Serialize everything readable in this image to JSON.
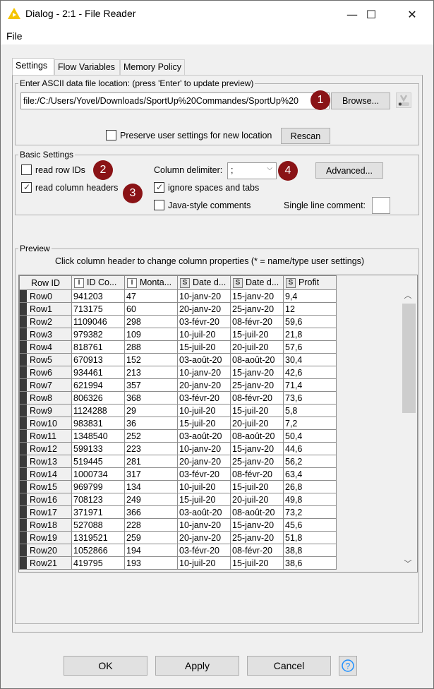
{
  "window": {
    "title": "Dialog - 2:1 - File Reader",
    "controls": {
      "minimize": "—",
      "maximize": "☐",
      "close": "✕"
    }
  },
  "menu": {
    "items": [
      "File"
    ]
  },
  "tabs": [
    {
      "label": "Settings",
      "active": true
    },
    {
      "label": "Flow Variables",
      "active": false
    },
    {
      "label": "Memory Policy",
      "active": false
    }
  ],
  "file_location": {
    "legend": "Enter ASCII data file location: (press 'Enter' to update preview)",
    "path": "file:/C:/Users/Yovel/Downloads/SportUp%20Commandes/SportUp%20",
    "browse_label": "Browse...",
    "preserve_label": "Preserve user settings for new location",
    "preserve_checked": false,
    "rescan_label": "Rescan"
  },
  "basic_settings": {
    "legend": "Basic Settings",
    "read_row_ids_label": "read row IDs",
    "read_row_ids_checked": false,
    "read_column_headers_label": "read column headers",
    "read_column_headers_checked": true,
    "column_delimiter_label": "Column delimiter:",
    "column_delimiter_value": ";",
    "advanced_label": "Advanced...",
    "ignore_spaces_label": "ignore spaces and tabs",
    "ignore_spaces_checked": true,
    "java_comments_label": "Java-style comments",
    "java_comments_checked": false,
    "single_line_comment_label": "Single line comment:",
    "single_line_comment_value": ""
  },
  "badges": [
    "1",
    "2",
    "3",
    "4"
  ],
  "preview": {
    "legend": "Preview",
    "hint": "Click column header to change column properties (* = name/type user settings)",
    "columns": [
      {
        "label": "Row ID",
        "type": ""
      },
      {
        "label": "ID Co...",
        "type": "I"
      },
      {
        "label": "Monta...",
        "type": "I"
      },
      {
        "label": "Date d...",
        "type": "S"
      },
      {
        "label": "Date d...",
        "type": "S"
      },
      {
        "label": "Profit",
        "type": "S"
      }
    ],
    "rows": [
      [
        "Row0",
        "941203",
        "47",
        "10-janv-20",
        "15-janv-20",
        "9,4"
      ],
      [
        "Row1",
        "713175",
        "60",
        "20-janv-20",
        "25-janv-20",
        "12"
      ],
      [
        "Row2",
        "1109046",
        "298",
        "03-févr-20",
        "08-févr-20",
        "59,6"
      ],
      [
        "Row3",
        "979382",
        "109",
        "10-juil-20",
        "15-juil-20",
        "21,8"
      ],
      [
        "Row4",
        "818761",
        "288",
        "15-juil-20",
        "20-juil-20",
        "57,6"
      ],
      [
        "Row5",
        "670913",
        "152",
        "03-août-20",
        "08-août-20",
        "30,4"
      ],
      [
        "Row6",
        "934461",
        "213",
        "10-janv-20",
        "15-janv-20",
        "42,6"
      ],
      [
        "Row7",
        "621994",
        "357",
        "20-janv-20",
        "25-janv-20",
        "71,4"
      ],
      [
        "Row8",
        "806326",
        "368",
        "03-févr-20",
        "08-févr-20",
        "73,6"
      ],
      [
        "Row9",
        "1124288",
        "29",
        "10-juil-20",
        "15-juil-20",
        "5,8"
      ],
      [
        "Row10",
        "983831",
        "36",
        "15-juil-20",
        "20-juil-20",
        "7,2"
      ],
      [
        "Row11",
        "1348540",
        "252",
        "03-août-20",
        "08-août-20",
        "50,4"
      ],
      [
        "Row12",
        "599133",
        "223",
        "10-janv-20",
        "15-janv-20",
        "44,6"
      ],
      [
        "Row13",
        "519445",
        "281",
        "20-janv-20",
        "25-janv-20",
        "56,2"
      ],
      [
        "Row14",
        "1000734",
        "317",
        "03-févr-20",
        "08-févr-20",
        "63,4"
      ],
      [
        "Row15",
        "969799",
        "134",
        "10-juil-20",
        "15-juil-20",
        "26,8"
      ],
      [
        "Row16",
        "708123",
        "249",
        "15-juil-20",
        "20-juil-20",
        "49,8"
      ],
      [
        "Row17",
        "371971",
        "366",
        "03-août-20",
        "08-août-20",
        "73,2"
      ],
      [
        "Row18",
        "527088",
        "228",
        "10-janv-20",
        "15-janv-20",
        "45,6"
      ],
      [
        "Row19",
        "1319521",
        "259",
        "20-janv-20",
        "25-janv-20",
        "51,8"
      ],
      [
        "Row20",
        "1052866",
        "194",
        "03-févr-20",
        "08-févr-20",
        "38,8"
      ],
      [
        "Row21",
        "419795",
        "193",
        "10-juil-20",
        "15-juil-20",
        "38,6"
      ]
    ]
  },
  "footer": {
    "ok_label": "OK",
    "apply_label": "Apply",
    "cancel_label": "Cancel",
    "help_icon": "?"
  },
  "colors": {
    "badge": "#8a1316",
    "title_icon": "#f5c400",
    "help_icon": "#1e90ff"
  }
}
